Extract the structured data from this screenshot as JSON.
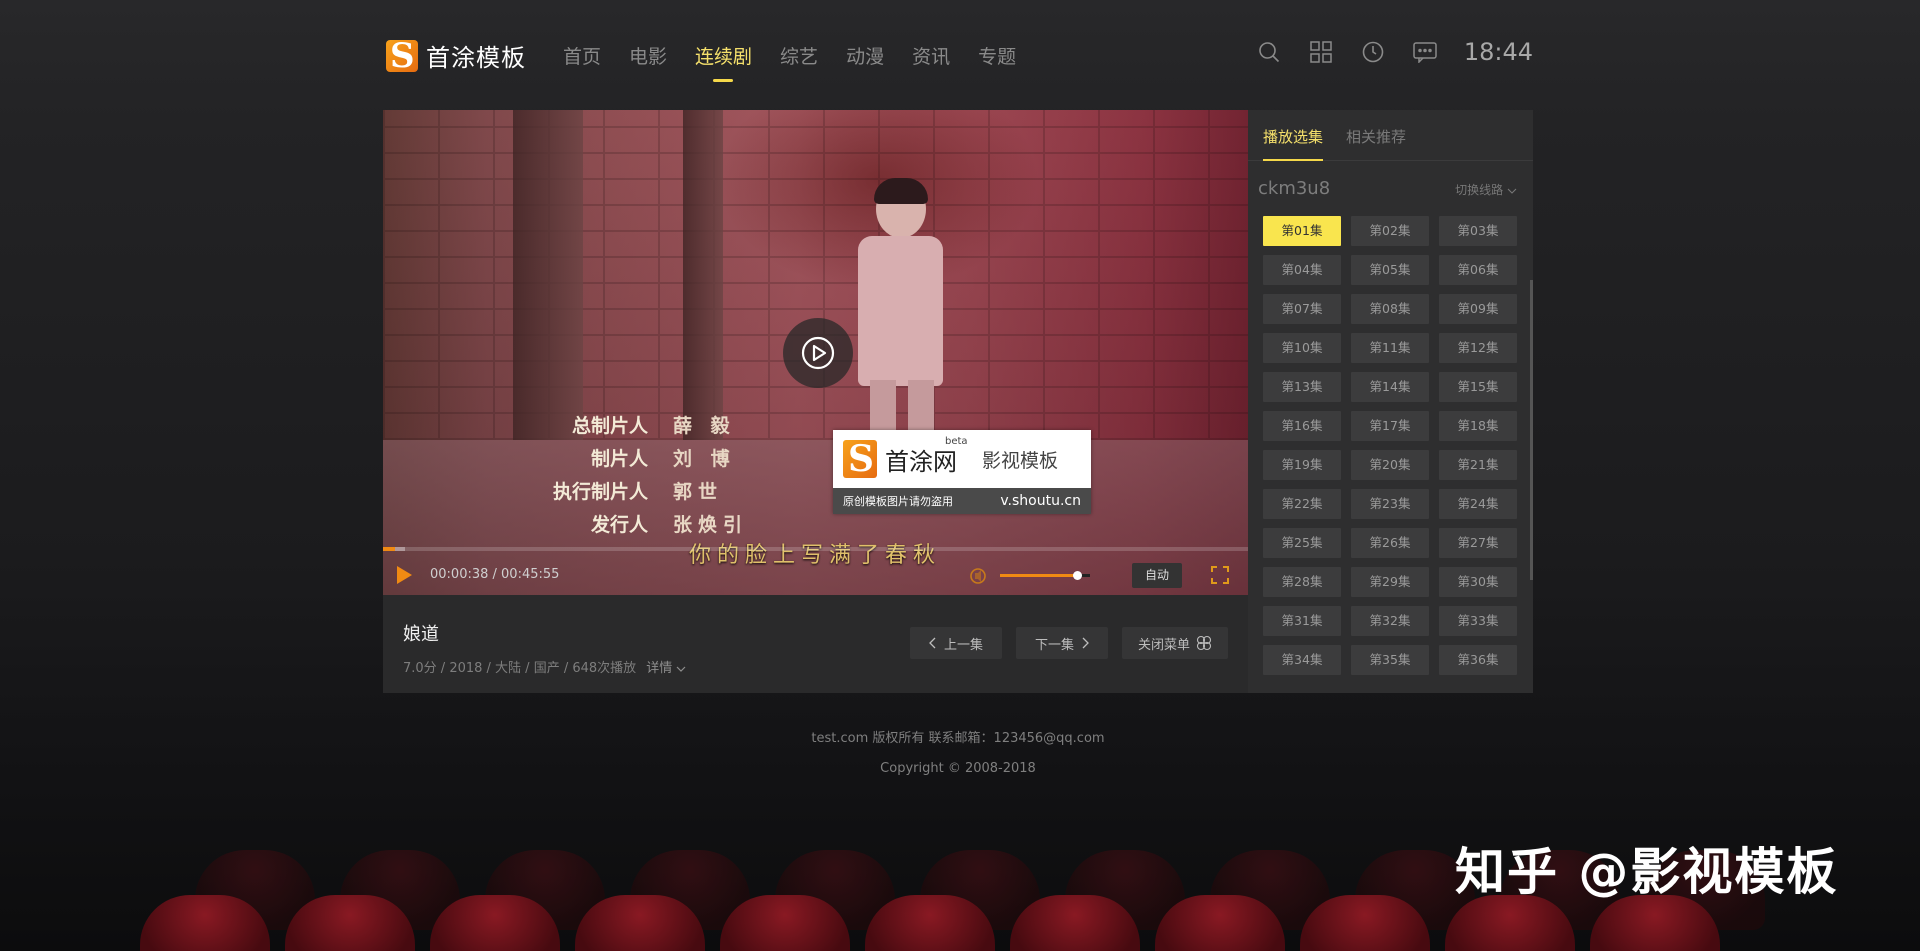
{
  "site": {
    "logo_text": "首涂模板",
    "logo_letter": "S"
  },
  "nav": {
    "items": [
      "首页",
      "电影",
      "连续剧",
      "综艺",
      "动漫",
      "资讯",
      "专题"
    ],
    "active": "连续剧"
  },
  "header": {
    "time": "18:44"
  },
  "player": {
    "time_current": "00:00:38",
    "time_total": "00:45:55",
    "time_display": "00:00:38 / 00:45:55",
    "progress": 0.014,
    "buffered": 0.026,
    "volume": 0.85,
    "auto_label": "自动",
    "credits": [
      {
        "role": "总制片人",
        "name": "薛 毅"
      },
      {
        "role": "制片人",
        "name": "刘 博"
      },
      {
        "role": "执行制片人",
        "name": "郭世"
      },
      {
        "role": "发行人",
        "name": "张焕引"
      }
    ],
    "subtitle": "你的脸上写满了春秋",
    "watermark": {
      "name": "首涂网",
      "beta": "beta",
      "slogan": "影视模板",
      "notice": "原创模板图片请勿盗用",
      "url": "v.shoutu.cn"
    }
  },
  "video": {
    "title": "娘道",
    "meta": "7.0分 / 2018 / 大陆 / 国产 / 648次播放",
    "details": "详情"
  },
  "buttons": {
    "prev": "上一集",
    "next": "下一集",
    "close_menu": "关闭菜单"
  },
  "sidebar": {
    "tabs": [
      "播放选集",
      "相关推荐"
    ],
    "source": "ckm3u8",
    "switch_label": "切换线路",
    "episodes": [
      "第01集",
      "第02集",
      "第03集",
      "第04集",
      "第05集",
      "第06集",
      "第07集",
      "第08集",
      "第09集",
      "第10集",
      "第11集",
      "第12集",
      "第13集",
      "第14集",
      "第15集",
      "第16集",
      "第17集",
      "第18集",
      "第19集",
      "第20集",
      "第21集",
      "第22集",
      "第23集",
      "第24集",
      "第25集",
      "第26集",
      "第27集",
      "第28集",
      "第29集",
      "第30集",
      "第31集",
      "第32集",
      "第33集",
      "第34集",
      "第35集",
      "第36集"
    ],
    "active_episode": "第01集"
  },
  "footer": {
    "line1": "test.com 版权所有 联系邮箱：123456@qq.com",
    "line2": "Copyright © 2008-2018"
  },
  "overlay": {
    "zhihu": "知乎 @影视模板"
  },
  "colors": {
    "accent": "#f5d84a",
    "progress": "#f08a13",
    "brand": "#f7a21b"
  }
}
